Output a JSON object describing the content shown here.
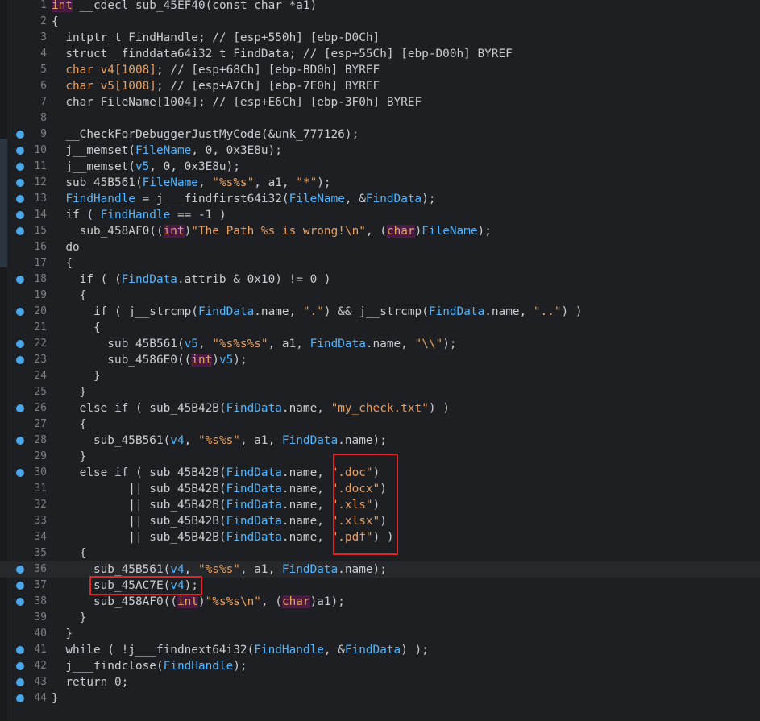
{
  "editor": {
    "lines": [
      {
        "n": "1",
        "c": [
          [
            "cast",
            "int"
          ],
          [
            "p",
            " __cdecl sub_45EF40(const char *a1)"
          ]
        ]
      },
      {
        "n": "2",
        "c": [
          [
            "p",
            "{"
          ]
        ]
      },
      {
        "n": "3",
        "c": [
          [
            "p",
            "  intptr_t FindHandle; // [esp+550h] [ebp-D0Ch]"
          ]
        ]
      },
      {
        "n": "4",
        "c": [
          [
            "p",
            "  struct _finddata64i32_t FindData; // [esp+55Ch] [ebp-D00h] BYREF"
          ]
        ]
      },
      {
        "n": "5",
        "c": [
          [
            "p",
            "  "
          ],
          [
            "ty2",
            "char v4[1008]"
          ],
          [
            "p",
            "; // [esp+68Ch] [ebp-BD0h] BYREF"
          ]
        ]
      },
      {
        "n": "6",
        "c": [
          [
            "p",
            "  "
          ],
          [
            "ty2",
            "char v5[1008]"
          ],
          [
            "p",
            "; // [esp+A7Ch] [ebp-7E0h] BYREF"
          ]
        ]
      },
      {
        "n": "7",
        "c": [
          [
            "p",
            "  char FileName[1004]; // [esp+E6Ch] [ebp-3F0h] BYREF"
          ]
        ]
      },
      {
        "n": "8",
        "c": [
          [
            "p",
            ""
          ]
        ]
      },
      {
        "n": "9",
        "d": 1,
        "c": [
          [
            "p",
            "  __CheckForDebuggerJustMyCode(&unk_777126);"
          ]
        ]
      },
      {
        "n": "10",
        "d": 1,
        "c": [
          [
            "p",
            "  j__memset("
          ],
          [
            "id",
            "FileName"
          ],
          [
            "p",
            ", 0, 0x3E8u);"
          ]
        ]
      },
      {
        "n": "11",
        "d": 1,
        "c": [
          [
            "p",
            "  j__memset("
          ],
          [
            "id",
            "v5"
          ],
          [
            "p",
            ", 0, 0x3E8u);"
          ]
        ]
      },
      {
        "n": "12",
        "d": 1,
        "c": [
          [
            "p",
            "  sub_45B561("
          ],
          [
            "id",
            "FileName"
          ],
          [
            "p",
            ", "
          ],
          [
            "str",
            "\"%s%s\""
          ],
          [
            "p",
            ", a1, "
          ],
          [
            "str",
            "\"*\""
          ],
          [
            "p",
            ");"
          ]
        ]
      },
      {
        "n": "13",
        "d": 1,
        "c": [
          [
            "id",
            "  FindHandle"
          ],
          [
            "p",
            " = j___findfirst64i32("
          ],
          [
            "id",
            "FileName"
          ],
          [
            "p",
            ", &"
          ],
          [
            "id",
            "FindData"
          ],
          [
            "p",
            ");"
          ]
        ]
      },
      {
        "n": "14",
        "d": 1,
        "c": [
          [
            "p",
            "  if ( "
          ],
          [
            "id",
            "FindHandle"
          ],
          [
            "p",
            " == -1 )"
          ]
        ]
      },
      {
        "n": "15",
        "d": 1,
        "c": [
          [
            "p",
            "    sub_458AF0(("
          ],
          [
            "cast",
            "int"
          ],
          [
            "p",
            ")"
          ],
          [
            "str",
            "\"The Path %s is wrong!\\n\""
          ],
          [
            "p",
            ", ("
          ],
          [
            "cast2",
            "char"
          ],
          [
            "p",
            ")"
          ],
          [
            "id",
            "FileName"
          ],
          [
            "p",
            ");"
          ]
        ]
      },
      {
        "n": "16",
        "c": [
          [
            "p",
            "  do"
          ]
        ]
      },
      {
        "n": "17",
        "c": [
          [
            "p",
            "  {"
          ]
        ]
      },
      {
        "n": "18",
        "d": 1,
        "c": [
          [
            "p",
            "    if ( ("
          ],
          [
            "id",
            "FindData"
          ],
          [
            "p",
            ".attrib & 0x10) != 0 )"
          ]
        ]
      },
      {
        "n": "19",
        "c": [
          [
            "p",
            "    {"
          ]
        ]
      },
      {
        "n": "20",
        "d": 1,
        "c": [
          [
            "p",
            "      if ( j__strcmp("
          ],
          [
            "id",
            "FindData"
          ],
          [
            "p",
            ".name, "
          ],
          [
            "str",
            "\".\""
          ],
          [
            "p",
            ") && j__strcmp("
          ],
          [
            "id",
            "FindData"
          ],
          [
            "p",
            ".name, "
          ],
          [
            "str",
            "\"..\""
          ],
          [
            "p",
            ") )"
          ]
        ]
      },
      {
        "n": "21",
        "c": [
          [
            "p",
            "      {"
          ]
        ]
      },
      {
        "n": "22",
        "d": 1,
        "c": [
          [
            "p",
            "        sub_45B561("
          ],
          [
            "id",
            "v5"
          ],
          [
            "p",
            ", "
          ],
          [
            "str",
            "\"%s%s%s\""
          ],
          [
            "p",
            ", a1, "
          ],
          [
            "id",
            "FindData"
          ],
          [
            "p",
            ".name, "
          ],
          [
            "str",
            "\"\\\\\""
          ],
          [
            "p",
            ");"
          ]
        ]
      },
      {
        "n": "23",
        "d": 1,
        "c": [
          [
            "p",
            "        sub_4586E0(("
          ],
          [
            "cast",
            "int"
          ],
          [
            "p",
            ")"
          ],
          [
            "id",
            "v5"
          ],
          [
            "p",
            ");"
          ]
        ]
      },
      {
        "n": "24",
        "c": [
          [
            "p",
            "      }"
          ]
        ]
      },
      {
        "n": "25",
        "c": [
          [
            "p",
            "    }"
          ]
        ]
      },
      {
        "n": "26",
        "d": 1,
        "c": [
          [
            "p",
            "    else if ( sub_45B42B("
          ],
          [
            "id",
            "FindData"
          ],
          [
            "p",
            ".name, "
          ],
          [
            "str",
            "\"my_check.txt\""
          ],
          [
            "p",
            ") )"
          ]
        ]
      },
      {
        "n": "27",
        "c": [
          [
            "p",
            "    {"
          ]
        ]
      },
      {
        "n": "28",
        "d": 1,
        "c": [
          [
            "p",
            "      sub_45B561("
          ],
          [
            "id",
            "v4"
          ],
          [
            "p",
            ", "
          ],
          [
            "str",
            "\"%s%s\""
          ],
          [
            "p",
            ", a1, "
          ],
          [
            "id",
            "FindData"
          ],
          [
            "p",
            ".name);"
          ]
        ]
      },
      {
        "n": "29",
        "c": [
          [
            "p",
            "    }"
          ]
        ]
      },
      {
        "n": "30",
        "d": 1,
        "c": [
          [
            "p",
            "    else if ( sub_45B42B("
          ],
          [
            "id",
            "FindData"
          ],
          [
            "p",
            ".name, "
          ],
          [
            "str",
            "\".doc\""
          ],
          [
            "p",
            ")"
          ]
        ]
      },
      {
        "n": "31",
        "c": [
          [
            "p",
            "           || sub_45B42B("
          ],
          [
            "id",
            "FindData"
          ],
          [
            "p",
            ".name, "
          ],
          [
            "str",
            "\".docx\""
          ],
          [
            "p",
            ")"
          ]
        ]
      },
      {
        "n": "32",
        "c": [
          [
            "p",
            "           || sub_45B42B("
          ],
          [
            "id",
            "FindData"
          ],
          [
            "p",
            ".name, "
          ],
          [
            "str",
            "\".xls\""
          ],
          [
            "p",
            ")"
          ]
        ]
      },
      {
        "n": "33",
        "c": [
          [
            "p",
            "           || sub_45B42B("
          ],
          [
            "id",
            "FindData"
          ],
          [
            "p",
            ".name, "
          ],
          [
            "str",
            "\".xlsx\""
          ],
          [
            "p",
            ")"
          ]
        ]
      },
      {
        "n": "34",
        "c": [
          [
            "p",
            "           || sub_45B42B("
          ],
          [
            "id",
            "FindData"
          ],
          [
            "p",
            ".name, "
          ],
          [
            "str",
            "\".pdf\""
          ],
          [
            "p",
            ") )"
          ]
        ]
      },
      {
        "n": "35",
        "c": [
          [
            "p",
            "    {"
          ]
        ]
      },
      {
        "n": "36",
        "d": 1,
        "h": 1,
        "c": [
          [
            "p",
            "      sub_45B561("
          ],
          [
            "id",
            "v4"
          ],
          [
            "p",
            ", "
          ],
          [
            "str",
            "\"%s%s\""
          ],
          [
            "p",
            ", a1, "
          ],
          [
            "id",
            "FindData"
          ],
          [
            "p",
            ".name);"
          ]
        ]
      },
      {
        "n": "37",
        "d": 1,
        "c": [
          [
            "p",
            "      sub_45AC7E("
          ],
          [
            "id",
            "v4"
          ],
          [
            "p",
            ");"
          ]
        ]
      },
      {
        "n": "38",
        "d": 1,
        "c": [
          [
            "p",
            "      sub_458AF0(("
          ],
          [
            "cast",
            "int"
          ],
          [
            "p",
            ")"
          ],
          [
            "str",
            "\"%s%s\\n\""
          ],
          [
            "p",
            ", ("
          ],
          [
            "cast2",
            "char"
          ],
          [
            "p",
            ")a1);"
          ]
        ]
      },
      {
        "n": "39",
        "c": [
          [
            "p",
            "    }"
          ]
        ]
      },
      {
        "n": "40",
        "c": [
          [
            "p",
            "  }"
          ]
        ]
      },
      {
        "n": "41",
        "d": 1,
        "c": [
          [
            "p",
            "  while ( !j___findnext64i32("
          ],
          [
            "id",
            "FindHandle"
          ],
          [
            "p",
            ", &"
          ],
          [
            "id",
            "FindData"
          ],
          [
            "p",
            ") );"
          ]
        ]
      },
      {
        "n": "42",
        "d": 1,
        "c": [
          [
            "p",
            "  j___findclose("
          ],
          [
            "id",
            "FindHandle"
          ],
          [
            "p",
            ");"
          ]
        ]
      },
      {
        "n": "43",
        "d": 1,
        "c": [
          [
            "p",
            "  return 0;"
          ]
        ]
      },
      {
        "n": "44",
        "d": 1,
        "c": [
          [
            "p",
            "}"
          ]
        ]
      }
    ]
  },
  "colors": {
    "background": "#1e1f22",
    "identifier": "#4fb6ff",
    "string": "#e8a060",
    "plain": "#c9ccd1",
    "cast_bg": "#4a1c44",
    "breakpoint_dot": "#4aa8ea",
    "highlight_box": "#e0242a"
  }
}
